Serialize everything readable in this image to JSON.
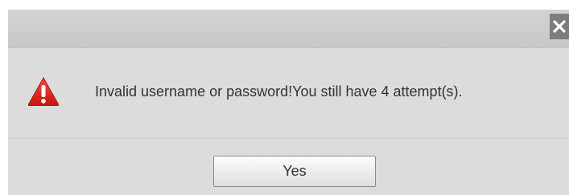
{
  "dialog": {
    "message": "Invalid username or password!You still have 4 attempt(s).",
    "yes_label": "Yes",
    "icons": {
      "close": "close-icon",
      "warning": "warning-triangle-icon"
    }
  },
  "colors": {
    "warning_red": "#d9231c",
    "dialog_background": "#dcdcdc",
    "close_button": "#7d7d7d"
  }
}
